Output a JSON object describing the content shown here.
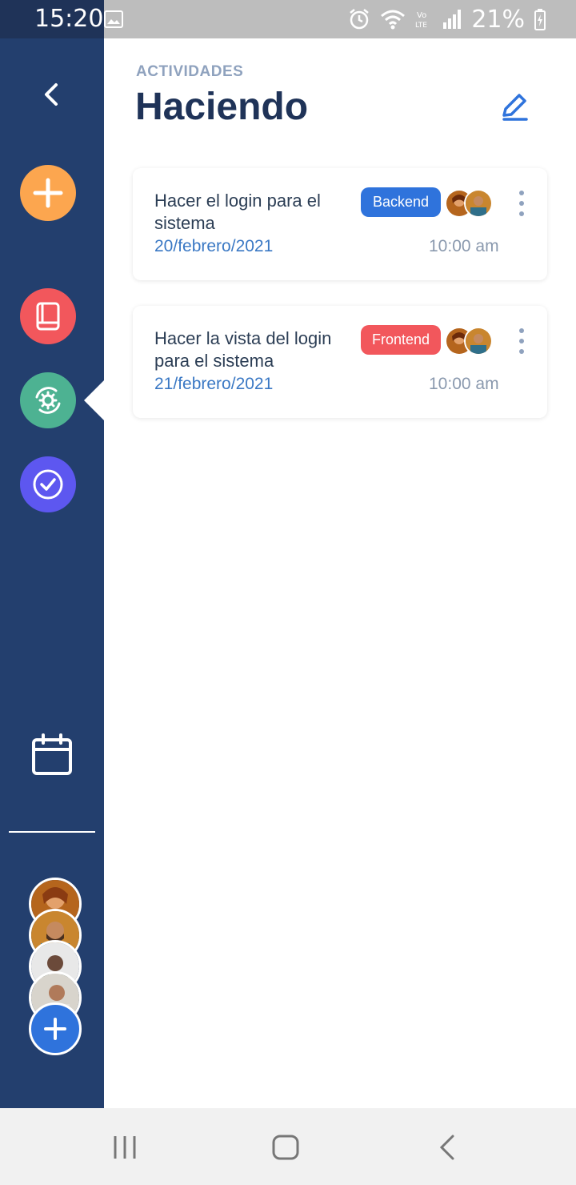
{
  "status_bar": {
    "time": "15:20",
    "battery_percent": "21%",
    "icons": [
      "image-icon",
      "alarm-icon",
      "wifi-icon",
      "volte-icon",
      "signal-icon",
      "battery-charging-icon"
    ]
  },
  "sidebar": {
    "back_icon": "chevron-left-icon",
    "buttons": [
      {
        "name": "add",
        "icon": "plus-icon",
        "color": "#fca64f"
      },
      {
        "name": "backlog",
        "icon": "book-icon",
        "color": "#f2575c"
      },
      {
        "name": "doing",
        "icon": "gear-cycle-icon",
        "color": "#4db292",
        "active": true
      },
      {
        "name": "done",
        "icon": "check-circle-icon",
        "color": "#5d57f0"
      }
    ],
    "calendar_icon": "calendar-icon",
    "members_count": 4,
    "add_member_icon": "plus-icon"
  },
  "header": {
    "section_label": "ACTIVIDADES",
    "title": "Haciendo",
    "edit_icon": "pencil-icon"
  },
  "tasks": [
    {
      "title": "Hacer el login para el sistema",
      "tag": "Backend",
      "tag_color": "#2f73dc",
      "date": "20/febrero/2021",
      "time": "10:00 am"
    },
    {
      "title": "Hacer la vista del login para el sistema",
      "tag": "Frontend",
      "tag_color": "#f2575c",
      "date": "21/febrero/2021",
      "time": "10:00 am"
    }
  ],
  "navbar": {
    "icons": [
      "recents-icon",
      "home-icon",
      "back-icon"
    ]
  },
  "colors": {
    "sidebar_bg": "#233f6e",
    "title": "#1f3358",
    "accent_blue": "#2f73dc",
    "accent_red": "#f2575c"
  }
}
